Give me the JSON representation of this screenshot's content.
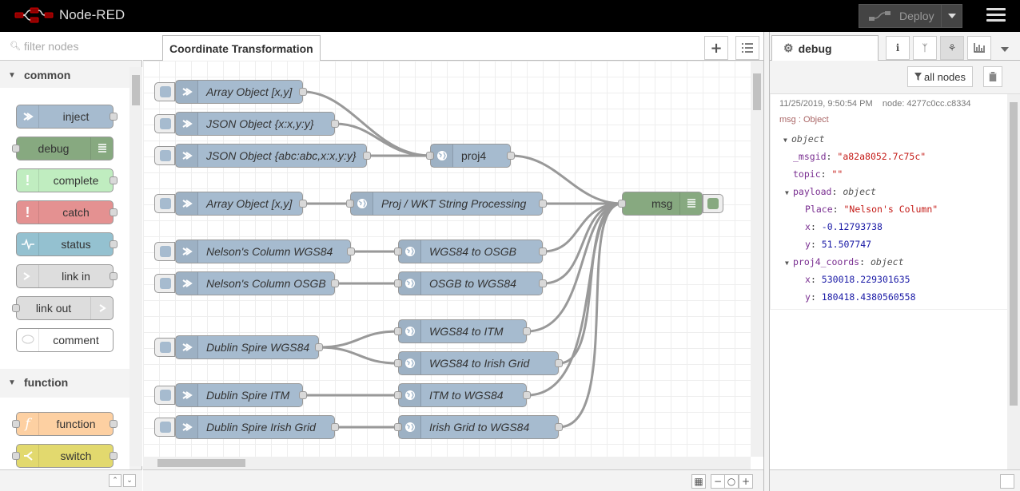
{
  "app": {
    "title": "Node-RED",
    "deploy_label": "Deploy"
  },
  "palette": {
    "filter_placeholder": "filter nodes",
    "categories": [
      {
        "name": "common",
        "nodes": [
          "inject",
          "debug",
          "complete",
          "catch",
          "status",
          "link in",
          "link out",
          "comment"
        ]
      },
      {
        "name": "function",
        "nodes": [
          "function",
          "switch"
        ]
      }
    ]
  },
  "workspace": {
    "tab_label": "Coordinate Transformation",
    "nodes": {
      "inj1": "Array Object [x,y]",
      "inj2": "JSON Object {x:x,y:y}",
      "inj3": "JSON Object {abc:abc,x:x,y:y}",
      "proj4": "proj4",
      "inj4": "Array Object [x,y]",
      "wkt": "Proj / WKT String Processing",
      "msg": "msg",
      "inj5": "Nelson's Column WGS84",
      "wgs_osgb": "WGS84 to OSGB",
      "inj6": "Nelson's Column OSGB",
      "osgb_wgs": "OSGB to WGS84",
      "inj7": "Dublin Spire WGS84",
      "wgs_itm": "WGS84 to ITM",
      "wgs_ig": "WGS84 to Irish Grid",
      "inj8": "Dublin Spire ITM",
      "itm_wgs": "ITM to WGS84",
      "inj9": "Dublin Spire Irish Grid",
      "ig_wgs": "Irish Grid to WGS84"
    }
  },
  "sidebar": {
    "tab_label": "debug",
    "filter_label": "all nodes",
    "message": {
      "timestamp": "11/25/2019, 9:50:54 PM",
      "node": "node: 4277c0cc.c8334",
      "topic": "msg : Object",
      "object_label": "object",
      "msgid_key": "_msgid",
      "msgid_val": "\"a82a8052.7c75c\"",
      "topic_key": "topic",
      "topic_val": "\"\"",
      "payload_key": "payload",
      "payload_type": "object",
      "place_key": "Place",
      "place_val": "\"Nelson's Column\"",
      "x_key": "x",
      "x_val": "-0.12793738",
      "y_key": "y",
      "y_val": "51.507747",
      "proj_key": "proj4_coords",
      "proj_type": "object",
      "px_key": "x",
      "px_val": "530018.229301635",
      "py_key": "y",
      "py_val": "180418.4380560558"
    }
  },
  "colors": {
    "function_node": "#a6bbcf",
    "debug_node": "#87a980",
    "inject_node": "#a6bbcf",
    "complete_node": "#c0edc0",
    "catch_node": "#e49191",
    "status_node": "#94c1d0",
    "link_node": "#dddddd",
    "function_fn": "#fdd0a2",
    "switch_node": "#e2d96e"
  }
}
